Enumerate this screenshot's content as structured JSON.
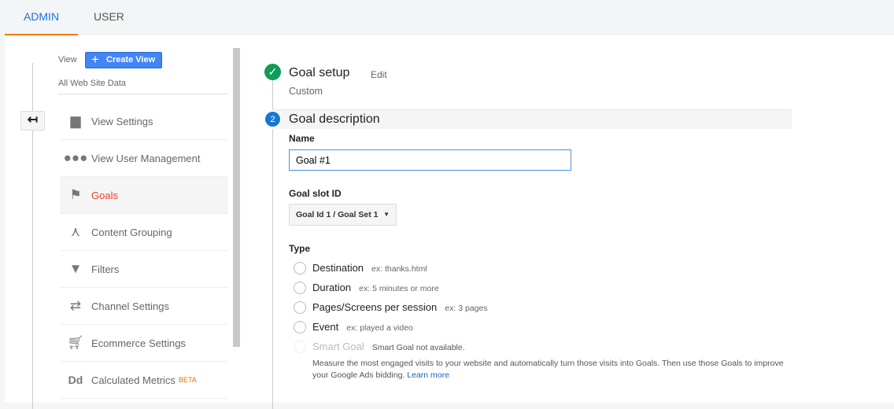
{
  "tabs": {
    "admin": "ADMIN",
    "user": "USER"
  },
  "sidebar": {
    "view_label": "View",
    "create_view": "Create View",
    "account": "All Web Site Data",
    "items": [
      {
        "label": "View Settings",
        "icon": "document-icon"
      },
      {
        "label": "View User Management",
        "icon": "users-icon"
      },
      {
        "label": "Goals",
        "icon": "flag-icon"
      },
      {
        "label": "Content Grouping",
        "icon": "grouping-icon"
      },
      {
        "label": "Filters",
        "icon": "filter-icon"
      },
      {
        "label": "Channel Settings",
        "icon": "channel-icon"
      },
      {
        "label": "Ecommerce Settings",
        "icon": "cart-icon"
      },
      {
        "label": "Calculated Metrics",
        "icon": "dd-icon",
        "badge": "BETA"
      }
    ]
  },
  "setup": {
    "title": "Goal setup",
    "edit": "Edit",
    "value": "Custom"
  },
  "description": {
    "step": "2",
    "title": "Goal description",
    "name_label": "Name",
    "name_value": "Goal #1",
    "slot_label": "Goal slot ID",
    "slot_value": "Goal Id 1 / Goal Set 1",
    "type_label": "Type",
    "types": [
      {
        "label": "Destination",
        "ex": "ex: thanks.html"
      },
      {
        "label": "Duration",
        "ex": "ex: 5 minutes or more"
      },
      {
        "label": "Pages/Screens per session",
        "ex": "ex: 3 pages"
      },
      {
        "label": "Event",
        "ex": "ex: played a video"
      },
      {
        "label": "Smart Goal",
        "ex": "Smart Goal not available."
      }
    ],
    "smart_desc": "Measure the most engaged visits to your website and automatically turn those visits into Goals. Then use those Goals to improve your Google Ads bidding.",
    "learn_more": "Learn more"
  },
  "colors": {
    "accent": "#1a73e8",
    "tab_underline": "#f57c00",
    "selected": "#e8432e",
    "success": "#0f9d58",
    "step": "#1976d2"
  }
}
